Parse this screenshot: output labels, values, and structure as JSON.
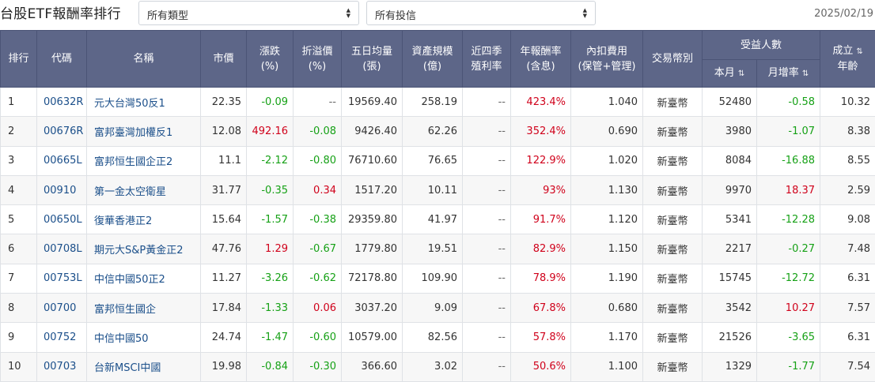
{
  "header": {
    "title": "台股ETF報酬率排行",
    "type_select": "所有類型",
    "issuer_select": "所有投信",
    "date": "2025/02/19"
  },
  "columns": {
    "rank": "排行",
    "code": "代碼",
    "name": "名稱",
    "price": "市價",
    "change_l1": "漲跌",
    "change_l2": "(%)",
    "premium_l1": "折溢價",
    "premium_l2": "(%)",
    "volume_l1": "五日均量",
    "volume_l2": "(張)",
    "aum_l1": "資產規模",
    "aum_l2": "(億)",
    "yield_l1": "近四季",
    "yield_l2": "殖利率",
    "return_l1": "年報酬率",
    "return_l2": "(含息)",
    "fee_l1": "內扣費用",
    "fee_l2": "(保管+管理)",
    "currency": "交易幣別",
    "holders_group": "受益人數",
    "holders_month": "本月",
    "holders_growth": "月增率",
    "age_l1": "成立",
    "age_l2": "年齡"
  },
  "rows": [
    {
      "rank": "1",
      "code": "00632R",
      "name": "元大台灣50反1",
      "price": "22.35",
      "change": "-0.09",
      "change_dir": "neg",
      "premium": "--",
      "premium_dir": "dim",
      "volume": "19569.40",
      "aum": "258.19",
      "yield": "--",
      "return": "423.4%",
      "fee": "1.040",
      "currency": "新臺幣",
      "holders": "52480",
      "growth": "-0.58",
      "growth_dir": "neg",
      "age": "10.32"
    },
    {
      "rank": "2",
      "code": "00676R",
      "name": "富邦臺灣加權反1",
      "price": "12.08",
      "change": "492.16",
      "change_dir": "pos",
      "premium": "-0.08",
      "premium_dir": "neg",
      "volume": "9426.40",
      "aum": "62.26",
      "yield": "--",
      "return": "352.4%",
      "fee": "0.690",
      "currency": "新臺幣",
      "holders": "3980",
      "growth": "-1.07",
      "growth_dir": "neg",
      "age": "8.38"
    },
    {
      "rank": "3",
      "code": "00665L",
      "name": "富邦恒生國企正2",
      "price": "11.1",
      "change": "-2.12",
      "change_dir": "neg",
      "premium": "-0.80",
      "premium_dir": "neg",
      "volume": "76710.60",
      "aum": "76.65",
      "yield": "--",
      "return": "122.9%",
      "fee": "1.020",
      "currency": "新臺幣",
      "holders": "8084",
      "growth": "-16.88",
      "growth_dir": "neg",
      "age": "8.55"
    },
    {
      "rank": "4",
      "code": "00910",
      "name": "第一金太空衛星",
      "price": "31.77",
      "change": "-0.35",
      "change_dir": "neg",
      "premium": "0.34",
      "premium_dir": "pos",
      "volume": "1517.20",
      "aum": "10.11",
      "yield": "--",
      "return": "93%",
      "fee": "1.130",
      "currency": "新臺幣",
      "holders": "9970",
      "growth": "18.37",
      "growth_dir": "pos",
      "age": "2.59"
    },
    {
      "rank": "5",
      "code": "00650L",
      "name": "復華香港正2",
      "price": "15.64",
      "change": "-1.57",
      "change_dir": "neg",
      "premium": "-0.38",
      "premium_dir": "neg",
      "volume": "29359.80",
      "aum": "41.97",
      "yield": "--",
      "return": "91.7%",
      "fee": "1.120",
      "currency": "新臺幣",
      "holders": "5341",
      "growth": "-12.28",
      "growth_dir": "neg",
      "age": "9.08"
    },
    {
      "rank": "6",
      "code": "00708L",
      "name": "期元大S&P黃金正2",
      "price": "47.76",
      "change": "1.29",
      "change_dir": "pos",
      "premium": "-0.67",
      "premium_dir": "neg",
      "volume": "1779.80",
      "aum": "19.51",
      "yield": "--",
      "return": "82.9%",
      "fee": "1.150",
      "currency": "新臺幣",
      "holders": "2217",
      "growth": "-0.27",
      "growth_dir": "neg",
      "age": "7.48"
    },
    {
      "rank": "7",
      "code": "00753L",
      "name": "中信中國50正2",
      "price": "11.27",
      "change": "-3.26",
      "change_dir": "neg",
      "premium": "-0.62",
      "premium_dir": "neg",
      "volume": "72178.80",
      "aum": "109.90",
      "yield": "--",
      "return": "78.9%",
      "fee": "1.190",
      "currency": "新臺幣",
      "holders": "15745",
      "growth": "-12.72",
      "growth_dir": "neg",
      "age": "6.31"
    },
    {
      "rank": "8",
      "code": "00700",
      "name": "富邦恒生國企",
      "price": "17.84",
      "change": "-1.33",
      "change_dir": "neg",
      "premium": "0.06",
      "premium_dir": "pos",
      "volume": "3037.20",
      "aum": "9.09",
      "yield": "--",
      "return": "67.8%",
      "fee": "0.680",
      "currency": "新臺幣",
      "holders": "3542",
      "growth": "10.27",
      "growth_dir": "pos",
      "age": "7.57"
    },
    {
      "rank": "9",
      "code": "00752",
      "name": "中信中國50",
      "price": "24.74",
      "change": "-1.47",
      "change_dir": "neg",
      "premium": "-0.60",
      "premium_dir": "neg",
      "volume": "10579.00",
      "aum": "82.56",
      "yield": "--",
      "return": "57.8%",
      "fee": "1.170",
      "currency": "新臺幣",
      "holders": "21526",
      "growth": "-3.65",
      "growth_dir": "neg",
      "age": "6.31"
    },
    {
      "rank": "10",
      "code": "00703",
      "name": "台新MSCI中國",
      "price": "19.98",
      "change": "-0.84",
      "change_dir": "neg",
      "premium": "-0.30",
      "premium_dir": "neg",
      "volume": "366.60",
      "aum": "3.02",
      "yield": "--",
      "return": "50.6%",
      "fee": "1.100",
      "currency": "新臺幣",
      "holders": "1329",
      "growth": "-1.77",
      "growth_dir": "neg",
      "age": "7.54"
    }
  ],
  "icons": {
    "sort": "sort-icon",
    "select_arrows": "up-down-caret-icon"
  },
  "colors": {
    "header_bg": "#5d6688",
    "positive": "#d0021b",
    "negative": "#16a116",
    "link": "#1b4f8a"
  }
}
